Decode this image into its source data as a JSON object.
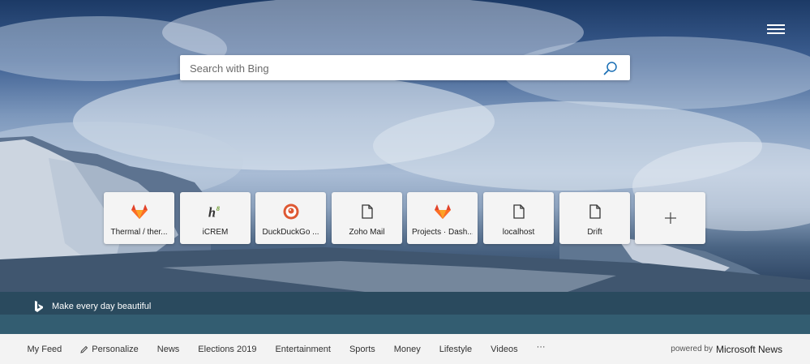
{
  "search": {
    "placeholder": "Search with Bing"
  },
  "icons": {
    "menu": "hamburger-icon",
    "search": "search-icon",
    "bing": "bing-logo-icon",
    "add": "plus-icon",
    "personalize": "pencil-icon",
    "more": "more-dots-icon"
  },
  "tiles": [
    {
      "label": "Thermal / ther...",
      "icon": "gitlab-icon"
    },
    {
      "label": "iCREM",
      "icon": "icrem-h8-icon"
    },
    {
      "label": "DuckDuckGo ...",
      "icon": "duckduckgo-icon"
    },
    {
      "label": "Zoho Mail",
      "icon": "page-icon"
    },
    {
      "label": "Projects · Dash...",
      "icon": "gitlab-icon"
    },
    {
      "label": "localhost",
      "icon": "page-icon"
    },
    {
      "label": "Drift",
      "icon": "page-icon"
    }
  ],
  "bing": {
    "tagline": "Make every day beautiful"
  },
  "nav": {
    "my_feed": "My Feed",
    "personalize": "Personalize",
    "news": "News",
    "elections": "Elections 2019",
    "entertainment": "Entertainment",
    "sports": "Sports",
    "money": "Money",
    "lifestyle": "Lifestyle",
    "videos": "Videos",
    "more": "···"
  },
  "footer": {
    "powered_by": "powered by",
    "brand": "Microsoft News"
  }
}
